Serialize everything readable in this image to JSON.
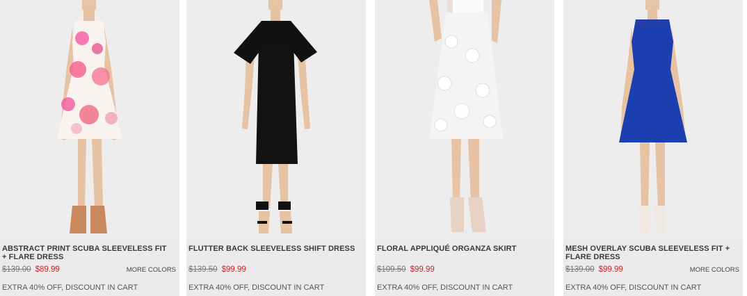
{
  "products": [
    {
      "name": "ABSTRACT PRINT SCUBA SLEEVELESS FIT + FLARE DRESS",
      "old_price": "$139.00",
      "sale_price": "$89.99",
      "more_colors": "MORE COLORS",
      "promo": "EXTRA 40% OFF, DISCOUNT IN CART"
    },
    {
      "name": "FLUTTER BACK SLEEVELESS SHIFT DRESS",
      "old_price": "$139.50",
      "sale_price": "$99.99",
      "more_colors": "",
      "promo": "EXTRA 40% OFF, DISCOUNT IN CART"
    },
    {
      "name": "FLORAL APPLIQUÉ ORGANZA SKIRT",
      "old_price": "$109.50",
      "sale_price": "$99.99",
      "more_colors": "",
      "promo": "EXTRA 40% OFF, DISCOUNT IN CART"
    },
    {
      "name": "MESH OVERLAY SCUBA SLEEVELESS FIT + FLARE DRESS",
      "old_price": "$139.00",
      "sale_price": "$99.99",
      "more_colors": "MORE COLORS",
      "promo": "EXTRA 40% OFF, DISCOUNT IN CART"
    }
  ],
  "colors": {
    "sale": "#d6222a",
    "tile_bg": "#ececec",
    "dress_1": "#f7f2ee",
    "dress_2": "#111111",
    "dress_3": "#f4f4f4",
    "dress_4": "#1b3fb0"
  }
}
